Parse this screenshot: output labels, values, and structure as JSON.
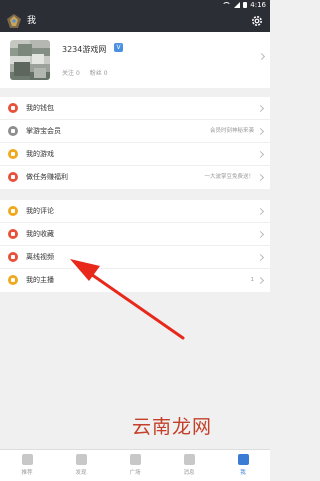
{
  "status_bar": {
    "time": "4:16"
  },
  "header": {
    "title": "我"
  },
  "profile": {
    "username": "3234游戏网",
    "badge": "V",
    "following_label": "关注",
    "following_count": "0",
    "fans_label": "粉丝",
    "fans_count": "0"
  },
  "menu_group_1": [
    {
      "label": "我的钱包",
      "sub": "",
      "color": "#e8523a"
    },
    {
      "label": "掌游宝会员",
      "sub": "会员时刻神秘来袭",
      "color": "#8e8e8e"
    },
    {
      "label": "我的游戏",
      "sub": "",
      "color": "#f2a81d"
    },
    {
      "label": "做任务赚福利",
      "sub": "一大波掌豆免费送！",
      "color": "#e8523a"
    }
  ],
  "menu_group_2": [
    {
      "label": "我的评论",
      "sub": "",
      "color": "#f2a81d"
    },
    {
      "label": "我的收藏",
      "sub": "",
      "color": "#e8523a"
    },
    {
      "label": "离线视频",
      "sub": "",
      "color": "#e8523a"
    },
    {
      "label": "我的主播",
      "sub": "1",
      "color": "#f2a81d"
    }
  ],
  "tabs": [
    {
      "label": "推荐",
      "active": false
    },
    {
      "label": "发现",
      "active": false
    },
    {
      "label": "广场",
      "active": false
    },
    {
      "label": "消息",
      "active": false
    },
    {
      "label": "我",
      "active": true
    }
  ],
  "watermark": "云南龙网"
}
